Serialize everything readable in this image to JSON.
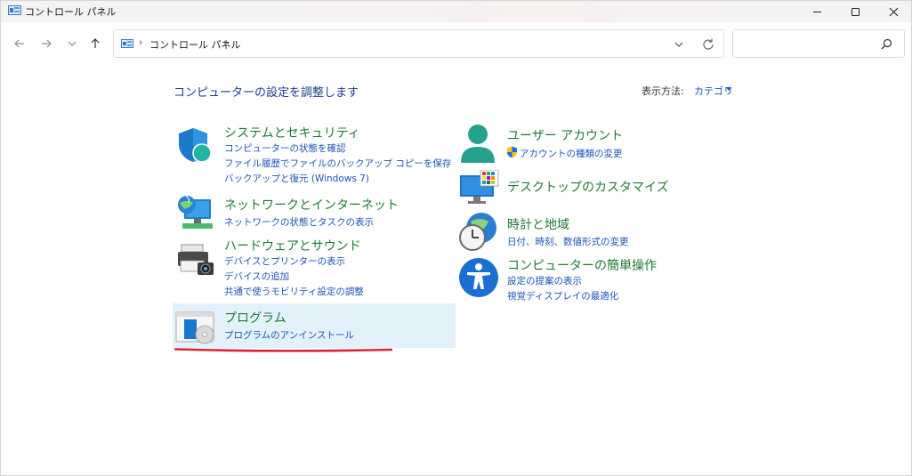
{
  "window": {
    "title": "コントロール パネル"
  },
  "address": {
    "separator": "›",
    "path": "コントロール パネル",
    "search_placeholder": ""
  },
  "content": {
    "heading": "コンピューターの設定を調整します",
    "view_by_label": "表示方法:",
    "view_by_value": "カテゴリ"
  },
  "categories": {
    "system": {
      "title": "システムとセキュリティ",
      "links": [
        "コンピューターの状態を確認",
        "ファイル履歴でファイルのバックアップ コピーを保存",
        "バックアップと復元 (Windows 7)"
      ]
    },
    "network": {
      "title": "ネットワークとインターネット",
      "links": [
        "ネットワークの状態とタスクの表示"
      ]
    },
    "hardware": {
      "title": "ハードウェアとサウンド",
      "links": [
        "デバイスとプリンターの表示",
        "デバイスの追加",
        "共通で使うモビリティ設定の調整"
      ]
    },
    "programs": {
      "title": "プログラム",
      "links": [
        "プログラムのアンインストール"
      ]
    },
    "user": {
      "title": "ユーザー アカウント",
      "links": [
        "アカウントの種類の変更"
      ]
    },
    "desktop": {
      "title": "デスクトップのカスタマイズ",
      "links": []
    },
    "clock": {
      "title": "時計と地域",
      "links": [
        "日付、時刻、数値形式の変更"
      ]
    },
    "ease": {
      "title": "コンピューターの簡単操作",
      "links": [
        "設定の提案の表示",
        "視覚ディスプレイの最適化"
      ]
    }
  },
  "colors": {
    "category_title": "#1f7a34",
    "link": "#1a55b8",
    "heading": "#1e3c8c",
    "highlight": "#e3f1fb",
    "underline": "#d8243a"
  }
}
